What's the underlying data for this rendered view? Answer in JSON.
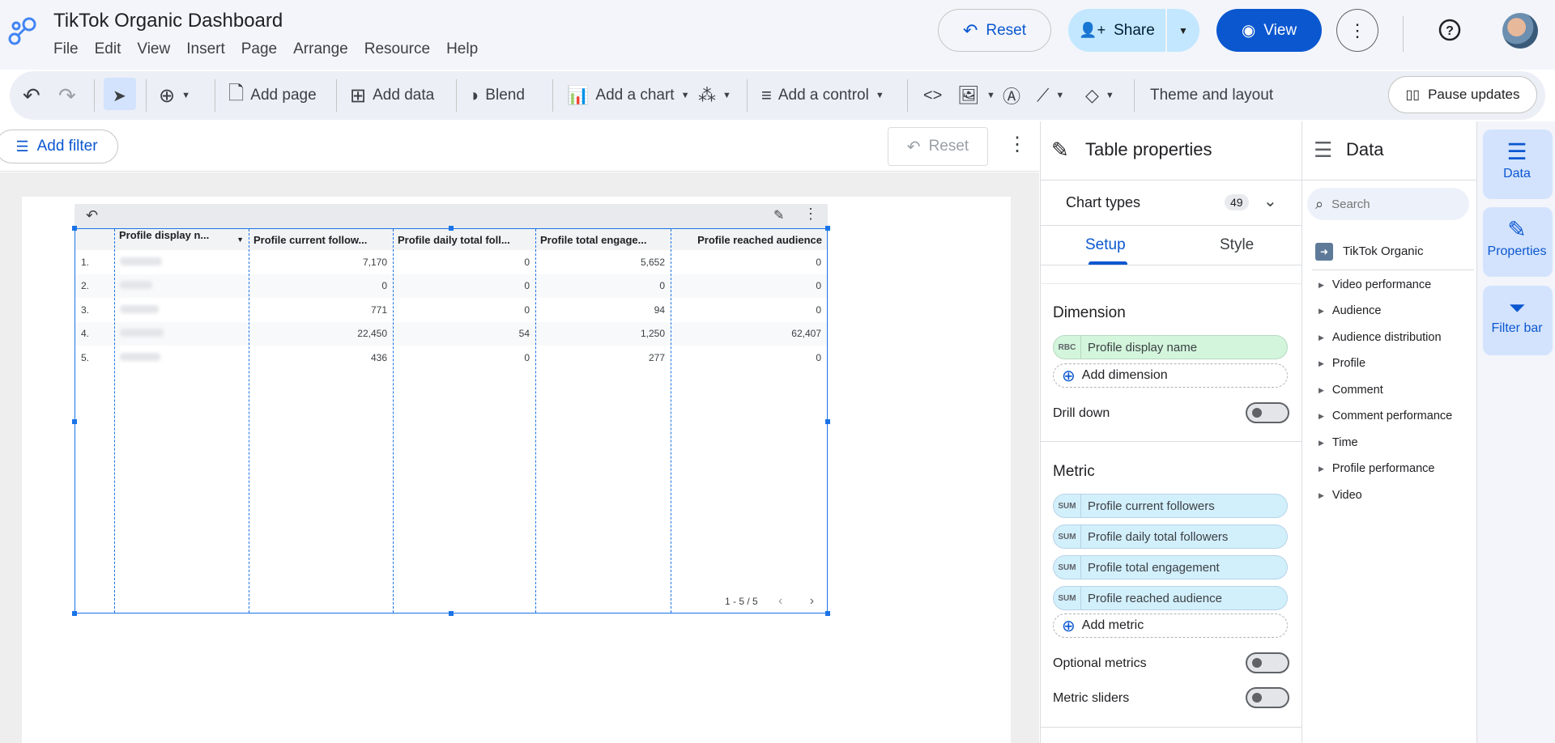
{
  "app": {
    "title": "TikTok Organic Dashboard"
  },
  "menu": [
    "File",
    "Edit",
    "View",
    "Insert",
    "Page",
    "Arrange",
    "Resource",
    "Help"
  ],
  "header": {
    "reset_label": "Reset",
    "share_label": "Share",
    "view_label": "View"
  },
  "toolbar": {
    "add_page": "Add page",
    "add_data": "Add data",
    "blend": "Blend",
    "add_chart": "Add a chart",
    "add_control": "Add a control",
    "theme_layout": "Theme and layout",
    "pause_updates": "Pause updates"
  },
  "filterbar": {
    "add_filter": "Add filter",
    "reset": "Reset"
  },
  "table": {
    "columns": [
      "Profile display n...",
      "Profile current follow...",
      "Profile daily total foll...",
      "Profile total engage...",
      "Profile reached audience"
    ],
    "rows": [
      {
        "idx": "1.",
        "followers": "7,170",
        "daily": "0",
        "engagement": "5,652",
        "reached": "0"
      },
      {
        "idx": "2.",
        "followers": "0",
        "daily": "0",
        "engagement": "0",
        "reached": "0"
      },
      {
        "idx": "3.",
        "followers": "771",
        "daily": "0",
        "engagement": "94",
        "reached": "0"
      },
      {
        "idx": "4.",
        "followers": "22,450",
        "daily": "54",
        "engagement": "1,250",
        "reached": "62,407"
      },
      {
        "idx": "5.",
        "followers": "436",
        "daily": "0",
        "engagement": "277",
        "reached": "0"
      }
    ],
    "pager": "1 - 5 / 5"
  },
  "properties": {
    "title": "Table properties",
    "chart_types": "Chart types",
    "chart_types_count": "49",
    "tabs": [
      "Setup",
      "Style"
    ],
    "dimension_heading": "Dimension",
    "dimension_chip": {
      "tag": "RBC",
      "label": "Profile display name"
    },
    "add_dimension": "Add dimension",
    "drill_down": "Drill down",
    "metric_heading": "Metric",
    "metrics": [
      {
        "tag": "SUM",
        "label": "Profile current followers"
      },
      {
        "tag": "SUM",
        "label": "Profile daily total followers"
      },
      {
        "tag": "SUM",
        "label": "Profile total engagement"
      },
      {
        "tag": "SUM",
        "label": "Profile reached audience"
      }
    ],
    "add_metric": "Add metric",
    "optional_metrics": "Optional metrics",
    "metric_sliders": "Metric sliders"
  },
  "data_panel": {
    "title": "Data",
    "search_placeholder": "Search",
    "source": "TikTok Organic",
    "groups": [
      "Video performance",
      "Audience",
      "Audience distribution",
      "Profile",
      "Comment",
      "Comment performance",
      "Time",
      "Profile performance",
      "Video"
    ]
  },
  "rail": {
    "data": "Data",
    "properties": "Properties",
    "filter_bar": "Filter bar"
  },
  "colors": {
    "accent": "#0b57d0",
    "selection": "#1a73e8",
    "dimension_chip": "#d3f5dc",
    "metric_chip": "#d2effc"
  }
}
